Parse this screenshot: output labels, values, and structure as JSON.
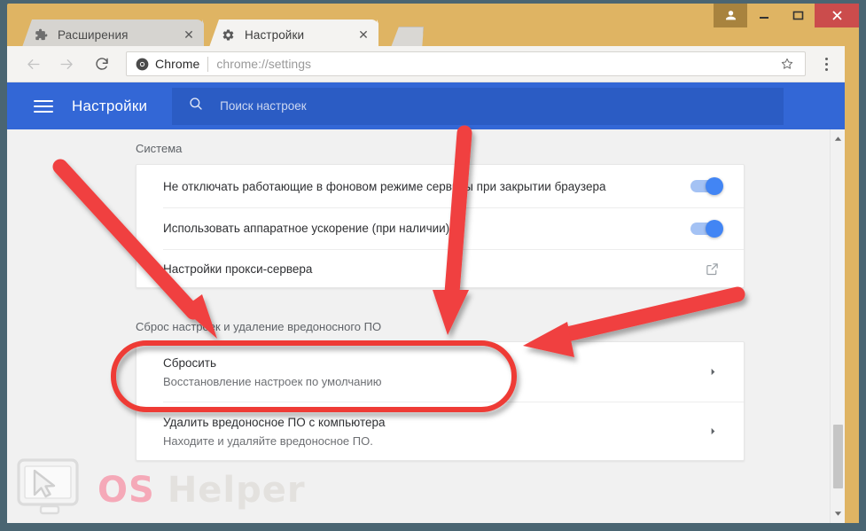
{
  "window": {
    "frame_color": "#dfb463",
    "desktop_color": "#4a6572",
    "controls": {
      "user_label": "user-account",
      "minimize_label": "minimize",
      "maximize_label": "maximize",
      "close_label": "close"
    }
  },
  "tabs": [
    {
      "title": "Расширения",
      "icon": "puzzle-icon",
      "active": false,
      "close_label": "✕"
    },
    {
      "title": "Настройки",
      "icon": "gear-icon",
      "active": true,
      "close_label": "✕"
    }
  ],
  "toolbar": {
    "back_label": "back",
    "forward_label": "forward",
    "reload_label": "reload",
    "scheme_label": "Chrome",
    "url": "chrome://settings",
    "bookmark_label": "bookmark",
    "menu_label": "menu"
  },
  "settings_header": {
    "menu_label": "main-menu",
    "title": "Настройки",
    "search_placeholder": "Поиск настроек",
    "bg_color": "#3367d6",
    "search_bg_color": "#2b5cc4"
  },
  "content": {
    "sections": [
      {
        "title": "Система",
        "rows": [
          {
            "label": "Не отключать работающие в фоновом режиме сервисы при закрытии браузера",
            "sub": "",
            "control": "toggle",
            "toggle_on": true
          },
          {
            "label": "Использовать аппаратное ускорение (при наличии)",
            "sub": "",
            "control": "toggle",
            "toggle_on": true
          },
          {
            "label": "Настройки прокси-сервера",
            "sub": "",
            "control": "external-link"
          }
        ]
      },
      {
        "title": "Сброс настроек и удаление вредоносного ПО",
        "rows": [
          {
            "label": "Сбросить",
            "sub": "Восстановление настроек по умолчанию",
            "control": "chevron",
            "highlighted": true
          },
          {
            "label": "Удалить вредоносное ПО с компьютера",
            "sub": "Находите и удаляйте вредоносное ПО.",
            "control": "chevron"
          }
        ]
      }
    ]
  },
  "scrollbar": {
    "up_arrow": "▲",
    "down_arrow": "▼"
  },
  "annotations": {
    "color": "#f0413f",
    "highlight_color": "#ee3b36",
    "items": [
      {
        "name": "arrow-from-top-left",
        "points_to": "Сброс настроек и удаление вредоносного ПО"
      },
      {
        "name": "arrow-from-top-center",
        "points_to": "Сброс настроек и удаление вредоносного ПО"
      },
      {
        "name": "arrow-from-right",
        "points_to": "Сбросить"
      },
      {
        "name": "highlight-oval",
        "surrounds": "Сбросить"
      }
    ]
  },
  "watermark": {
    "brand_first": "OS",
    "brand_second": "Helper",
    "first_color": "#f5a9b8",
    "second_color": "#e3e1de"
  }
}
